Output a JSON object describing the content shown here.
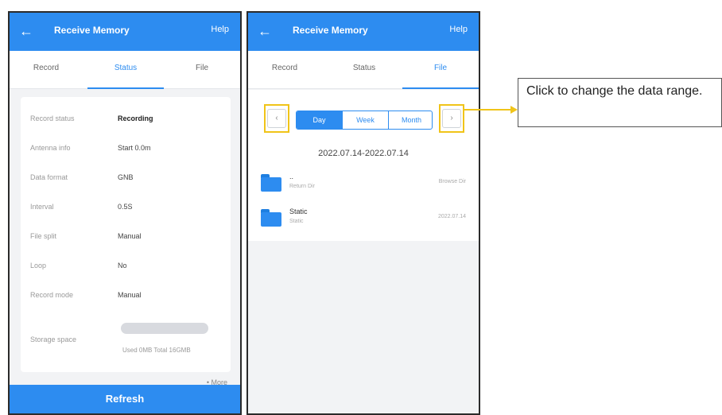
{
  "left_phone": {
    "appbar": {
      "back_icon": "arrow-left-icon",
      "title": "Receive Memory",
      "help": "Help"
    },
    "tabs": [
      "Record",
      "Status",
      "File"
    ],
    "active_tab": "Status",
    "status_rows": [
      {
        "key": "Record status",
        "value": "Recording"
      },
      {
        "key": "Antenna info",
        "value": "Start 0.0m"
      },
      {
        "key": "Data format",
        "value": "GNB"
      },
      {
        "key": "Interval",
        "value": "0.5S"
      },
      {
        "key": "File split",
        "value": "Manual"
      },
      {
        "key": "Loop",
        "value": "No"
      },
      {
        "key": "Record mode",
        "value": "Manual"
      }
    ],
    "storage": {
      "label": "Storage space",
      "detail": "Used 0MB Total 16GMB"
    },
    "more": "• More",
    "refresh": "Refresh"
  },
  "right_phone": {
    "appbar": {
      "back_icon": "arrow-left-icon",
      "title": "Receive Memory",
      "help": "Help"
    },
    "tabs": [
      "Record",
      "Status",
      "File"
    ],
    "active_tab": "File",
    "range_options": [
      "Day",
      "Week",
      "Month"
    ],
    "selected_range": "Day",
    "prev_icon": "chevron-left-icon",
    "next_icon": "chevron-right-icon",
    "date_range": "2022.07.14-2022.07.14",
    "files": [
      {
        "name": "..",
        "sub": "Return Dir",
        "right": "Browse Dir"
      },
      {
        "name": "Static",
        "sub": "Static",
        "right": "2022.07.14"
      }
    ]
  },
  "callout": {
    "text": "Click to change the data range."
  },
  "colors": {
    "accent": "#2d8cf0",
    "highlight": "#f0c419"
  }
}
